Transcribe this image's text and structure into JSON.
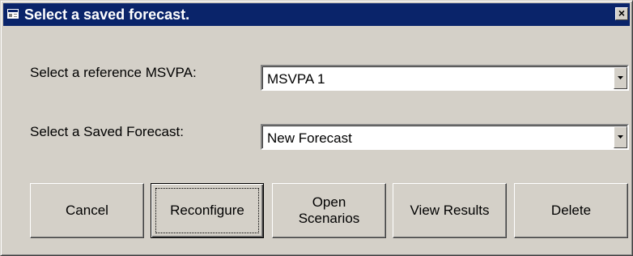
{
  "window": {
    "title": "Select a saved forecast.",
    "icon": "form-icon",
    "close_label": "×"
  },
  "form": {
    "msvpa_label": "Select a reference MSVPA:",
    "msvpa_value": "MSVPA 1",
    "forecast_label": "Select a Saved Forecast:",
    "forecast_value": "New Forecast"
  },
  "buttons": {
    "cancel": "Cancel",
    "reconfigure": "Reconfigure",
    "open_scenarios": "Open\nScenarios",
    "view_results": "View Results",
    "delete": "Delete"
  },
  "colors": {
    "titlebar": "#0a246a",
    "face": "#d4d0c8"
  }
}
